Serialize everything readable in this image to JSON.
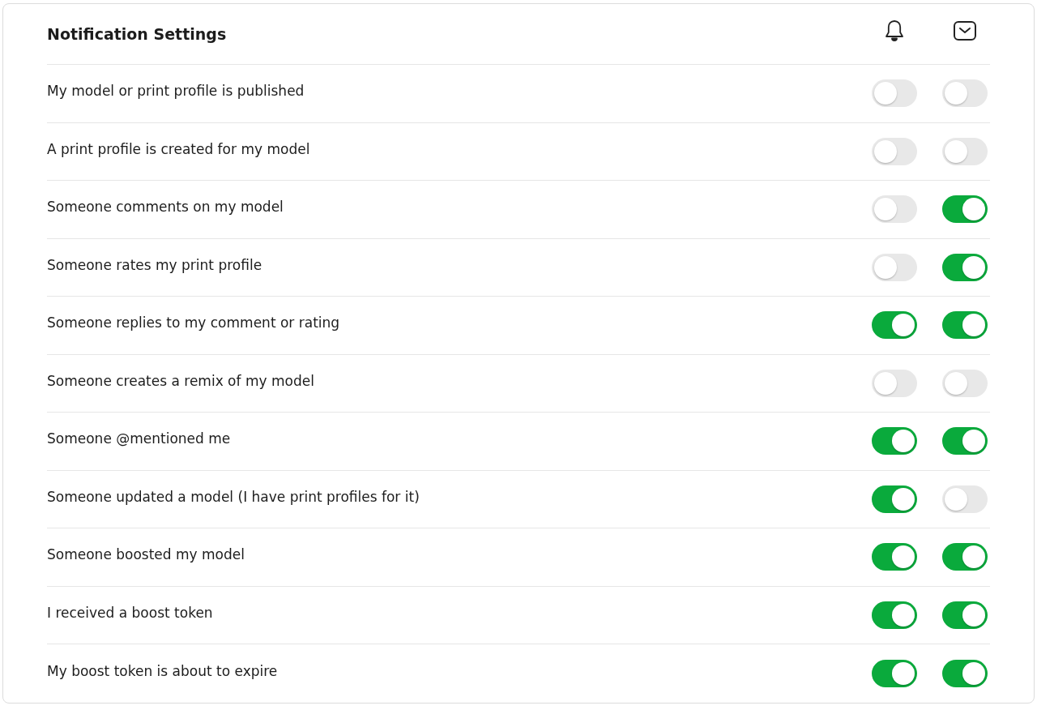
{
  "title": "Notification Settings",
  "settings": [
    {
      "label": "My model or print profile is published",
      "push": false,
      "email": false
    },
    {
      "label": "A print profile is created for my model",
      "push": false,
      "email": false
    },
    {
      "label": "Someone comments on my model",
      "push": false,
      "email": true
    },
    {
      "label": "Someone rates my print profile",
      "push": false,
      "email": true
    },
    {
      "label": "Someone replies to my comment or rating",
      "push": true,
      "email": true
    },
    {
      "label": "Someone creates a remix of my model",
      "push": false,
      "email": false
    },
    {
      "label": "Someone @mentioned me",
      "push": true,
      "email": true
    },
    {
      "label": "Someone updated a model (I have print profiles for it)",
      "push": true,
      "email": false
    },
    {
      "label": "Someone boosted my model",
      "push": true,
      "email": true
    },
    {
      "label": "I received a boost token",
      "push": true,
      "email": true
    },
    {
      "label": "My boost token is about to expire",
      "push": true,
      "email": true
    }
  ]
}
